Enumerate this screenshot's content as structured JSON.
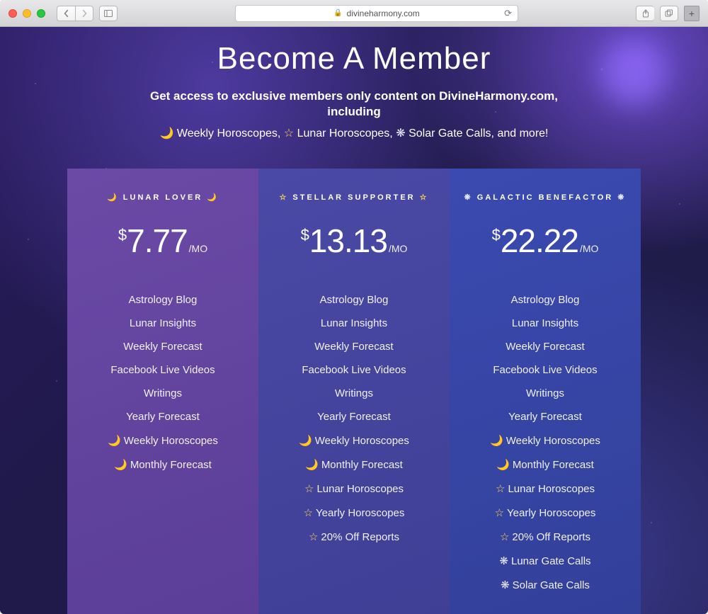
{
  "browser": {
    "url_display": "divineharmony.com"
  },
  "hero": {
    "title": "Become A Member",
    "subtitle_line1": "Get access to exclusive members only content on DivineHarmony.com,",
    "subtitle_line2": "including",
    "subtitle_line3_a": "Weekly Horoscopes,",
    "subtitle_line3_b": "Lunar Horoscopes,",
    "subtitle_line3_c": "Solar Gate Calls, and more!"
  },
  "icons": {
    "moon": "☽",
    "crescent": "🌙",
    "star": "☆",
    "sun": "❋"
  },
  "plans": [
    {
      "name": "Lunar Lover",
      "icon": "moon",
      "currency": "$",
      "price": "7.77",
      "period": "/mo",
      "features": [
        {
          "label": "Astrology Blog",
          "icon": ""
        },
        {
          "label": "Lunar Insights",
          "icon": ""
        },
        {
          "label": "Weekly Forecast",
          "icon": ""
        },
        {
          "label": "Facebook Live Videos",
          "icon": ""
        },
        {
          "label": "Writings",
          "icon": ""
        },
        {
          "label": "Yearly Forecast",
          "icon": ""
        },
        {
          "label": "Weekly Horoscopes",
          "icon": "moon"
        },
        {
          "label": "Monthly Forecast",
          "icon": "moon"
        }
      ]
    },
    {
      "name": "Stellar Supporter",
      "icon": "star",
      "currency": "$",
      "price": "13.13",
      "period": "/mo",
      "features": [
        {
          "label": "Astrology Blog",
          "icon": ""
        },
        {
          "label": "Lunar Insights",
          "icon": ""
        },
        {
          "label": "Weekly Forecast",
          "icon": ""
        },
        {
          "label": "Facebook Live Videos",
          "icon": ""
        },
        {
          "label": "Writings",
          "icon": ""
        },
        {
          "label": "Yearly Forecast",
          "icon": ""
        },
        {
          "label": "Weekly Horoscopes",
          "icon": "moon"
        },
        {
          "label": "Monthly Forecast",
          "icon": "moon"
        },
        {
          "label": "Lunar Horoscopes",
          "icon": "star"
        },
        {
          "label": "Yearly Horoscopes",
          "icon": "star"
        },
        {
          "label": "20% Off Reports",
          "icon": "star"
        }
      ]
    },
    {
      "name": "Galactic Benefactor",
      "icon": "sun",
      "currency": "$",
      "price": "22.22",
      "period": "/mo",
      "features": [
        {
          "label": "Astrology Blog",
          "icon": ""
        },
        {
          "label": "Lunar Insights",
          "icon": ""
        },
        {
          "label": "Weekly Forecast",
          "icon": ""
        },
        {
          "label": "Facebook Live Videos",
          "icon": ""
        },
        {
          "label": "Writings",
          "icon": ""
        },
        {
          "label": "Yearly Forecast",
          "icon": ""
        },
        {
          "label": "Weekly Horoscopes",
          "icon": "moon"
        },
        {
          "label": "Monthly Forecast",
          "icon": "moon"
        },
        {
          "label": "Lunar Horoscopes",
          "icon": "star"
        },
        {
          "label": "Yearly Horoscopes",
          "icon": "star"
        },
        {
          "label": "20% Off Reports",
          "icon": "star"
        },
        {
          "label": "Lunar Gate Calls",
          "icon": "sun"
        },
        {
          "label": "Solar Gate Calls",
          "icon": "sun"
        }
      ]
    }
  ]
}
